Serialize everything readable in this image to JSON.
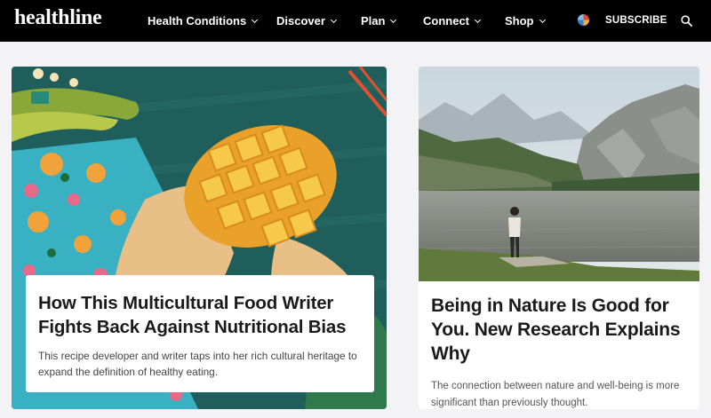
{
  "header": {
    "logo": "healthline",
    "nav": [
      {
        "label": "Health Conditions"
      },
      {
        "label": "Discover"
      },
      {
        "label": "Plan"
      },
      {
        "label": "Connect"
      },
      {
        "label": "Shop"
      }
    ],
    "subscribe_label": "SUBSCRIBE"
  },
  "articles": [
    {
      "title": "How This Multicultural Food Writer Fights Back Against Nutritional Bias",
      "description": "This recipe developer and writer taps into her rich cultural heritage to expand the definition of healthy eating."
    },
    {
      "title": "Being in Nature Is Good for You. New Research Explains Why",
      "description": "The connection between nature and well-being is more significant than previously thought."
    }
  ],
  "colors": {
    "nav_bg": "#000000",
    "page_bg": "#f3f3f5",
    "illustration_bg": "#1f5e5a",
    "mango": "#f2b93a",
    "water": "#8a8d89"
  },
  "icons": [
    "chevron-down-icon",
    "avatar",
    "search-icon"
  ]
}
